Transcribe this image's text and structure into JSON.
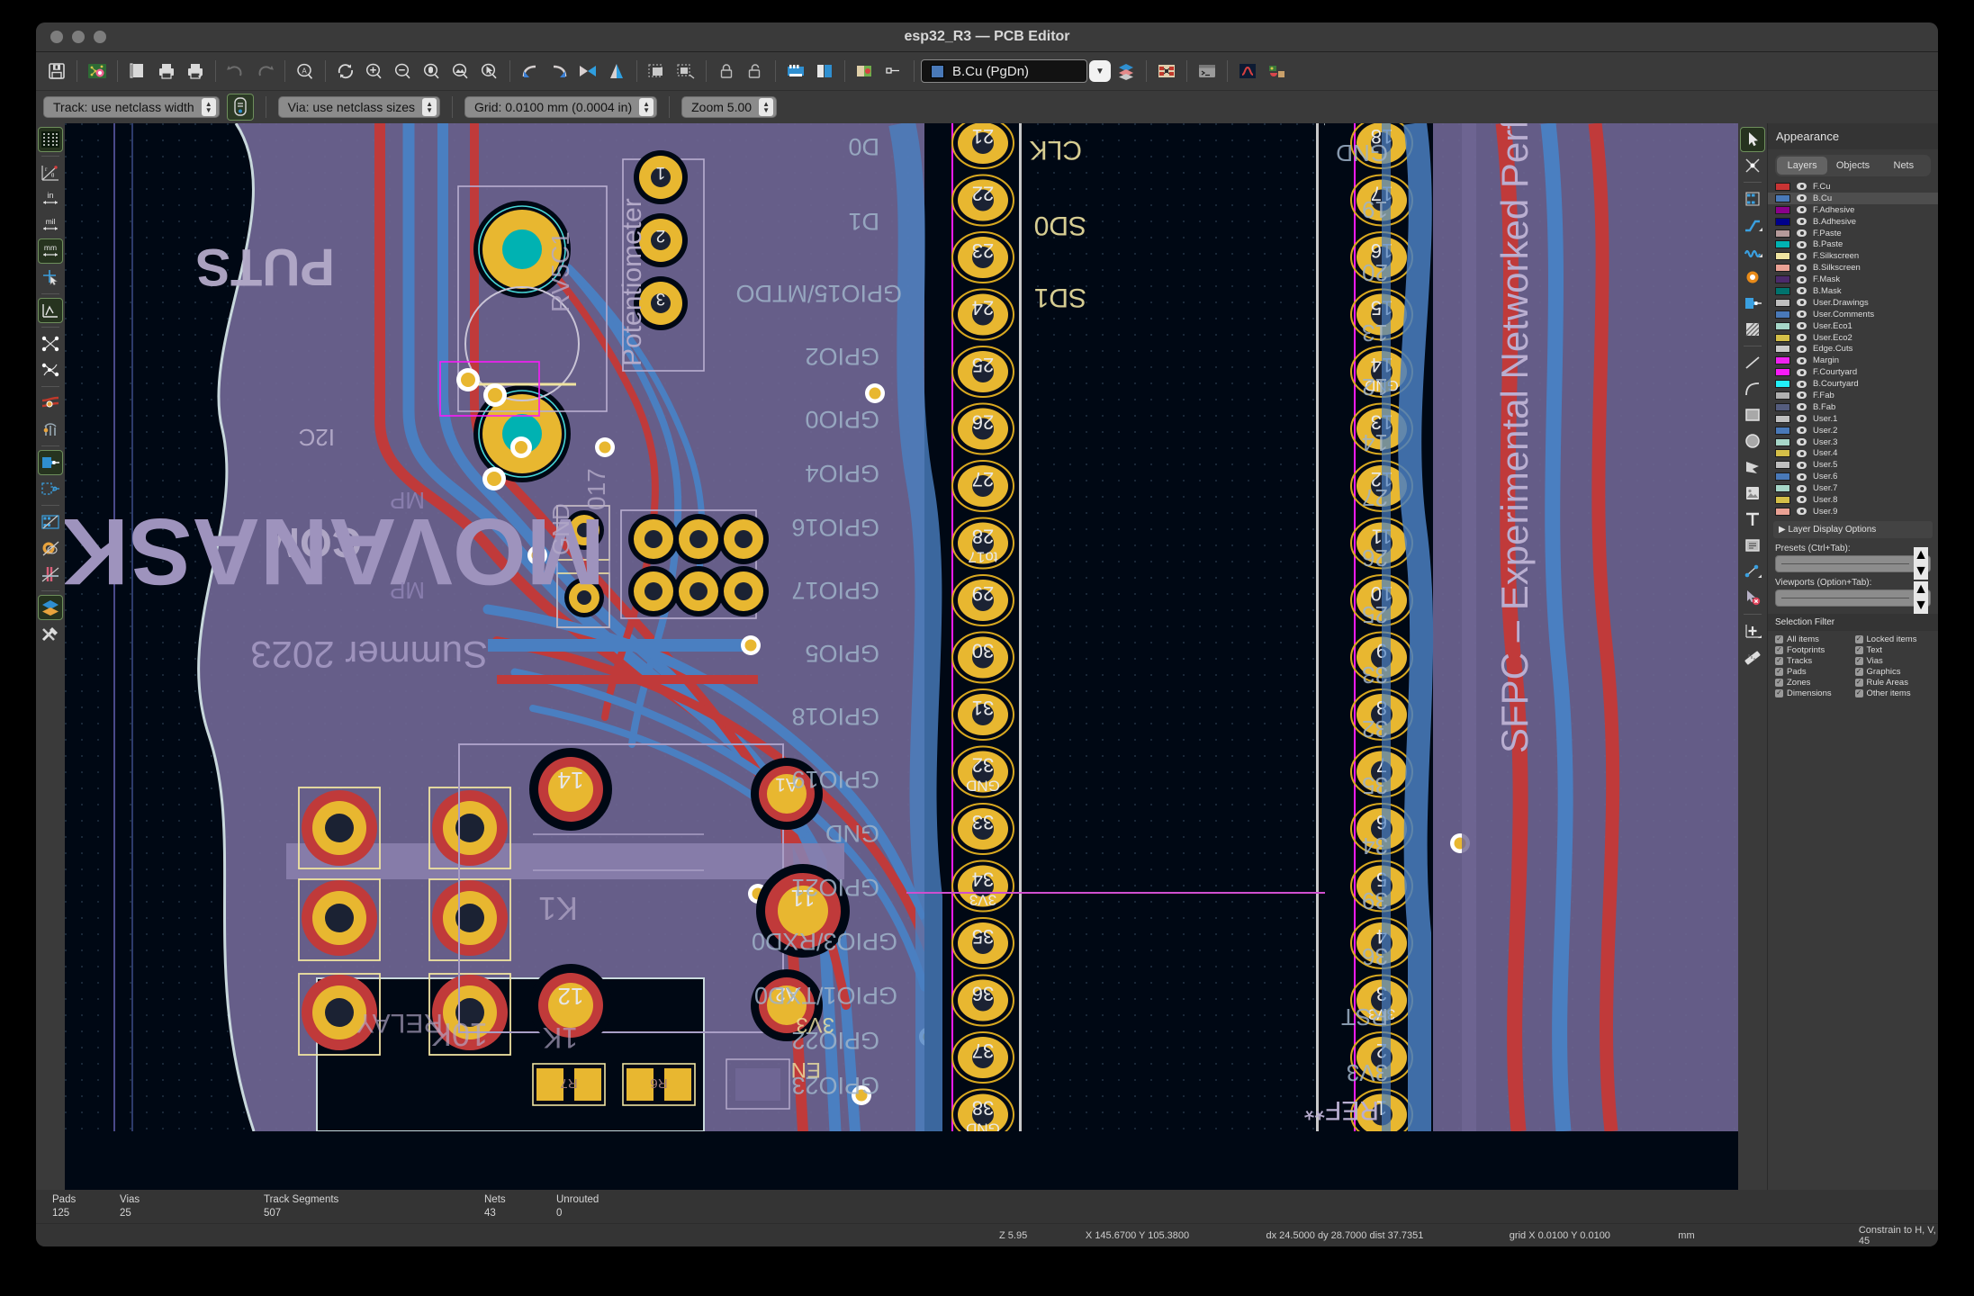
{
  "window": {
    "title": "esp32_R3 — PCB Editor"
  },
  "toolbar_main": [
    {
      "name": "save-icon",
      "label": "Save"
    },
    {
      "name": "board-setup-icon",
      "label": "Board Setup"
    },
    {
      "name": "page-settings-icon",
      "label": "Page Settings"
    },
    {
      "name": "print-icon",
      "label": "Print"
    },
    {
      "name": "plot-icon",
      "label": "Plot"
    },
    {
      "name": "undo-icon",
      "label": "Undo"
    },
    {
      "name": "redo-icon",
      "label": "Redo"
    },
    {
      "name": "find-icon",
      "label": "Find"
    },
    {
      "name": "refresh-icon",
      "label": "Refresh"
    },
    {
      "name": "zoom-in-icon",
      "label": "Zoom In"
    },
    {
      "name": "zoom-out-icon",
      "label": "Zoom Out"
    },
    {
      "name": "zoom-fit-icon",
      "label": "Zoom to Fit"
    },
    {
      "name": "zoom-objects-icon",
      "label": "Zoom to Objects"
    },
    {
      "name": "zoom-selection-icon",
      "label": "Zoom to Selection"
    },
    {
      "name": "rotate-ccw-icon",
      "label": "Rotate Counterclockwise"
    },
    {
      "name": "rotate-cw-icon",
      "label": "Rotate Clockwise"
    },
    {
      "name": "mirror-h-icon",
      "label": "Mirror Horizontally"
    },
    {
      "name": "mirror-v-icon",
      "label": "Mirror Vertically"
    },
    {
      "name": "group-icon",
      "label": "Group"
    },
    {
      "name": "ungroup-icon",
      "label": "Ungroup"
    },
    {
      "name": "footprint-lock-icon",
      "label": "Lock"
    },
    {
      "name": "footprint-unlock-icon",
      "label": "Unlock"
    },
    {
      "name": "drc-icon",
      "label": "Design Rules Checker"
    },
    {
      "name": "footprint-editor-icon",
      "label": "Footprint Editor"
    },
    {
      "name": "footprint-library-icon",
      "label": "Footprint Library"
    },
    {
      "name": "netlist-icon",
      "label": "Netlist"
    }
  ],
  "toolbar_aux": {
    "track": {
      "value": "Track: use netclass width"
    },
    "track_edit_icon": "track-width-edit-icon",
    "via": {
      "value": "Via: use netclass sizes"
    },
    "grid": {
      "value": "Grid: 0.0100 mm (0.0004 in)"
    },
    "zoom": {
      "value": "Zoom 5.00"
    }
  },
  "layer_selector": {
    "value": "B.Cu (PgDn)",
    "color": "#4979b8",
    "icons": [
      "layers-stack-icon",
      "terminal-icon",
      "python-icon",
      "plugin-icon",
      "3d-viewer-icon",
      "ratsnest-icon"
    ]
  },
  "left_toolbar": [
    {
      "name": "toggle-grid-icon",
      "active": true
    },
    {
      "name": "polar-coordinates-icon",
      "active": false
    },
    {
      "name": "units-inches-icon",
      "active": false
    },
    {
      "name": "units-mils-icon",
      "active": false
    },
    {
      "name": "units-mm-icon",
      "active": true
    },
    {
      "name": "cursor-fullscreen-icon",
      "active": false
    },
    {
      "name": "show-ratsnest-icon",
      "active": true
    },
    {
      "name": "curved-ratsnest-icon",
      "active": false
    },
    {
      "name": "net-colors-icon",
      "active": false
    },
    {
      "name": "ratsnest-mode-icon",
      "active": false
    },
    {
      "name": "zone-filled-icon",
      "active": true
    },
    {
      "name": "zone-outline-icon",
      "active": false
    },
    {
      "name": "footprint-sketch-icon",
      "active": false
    },
    {
      "name": "pad-sketch-icon",
      "active": false
    },
    {
      "name": "track-sketch-icon",
      "active": false
    },
    {
      "name": "layers-contrast-icon",
      "active": true
    },
    {
      "name": "preferences-icon",
      "active": false
    }
  ],
  "right_toolbar": [
    {
      "name": "select-tool-icon",
      "active": true
    },
    {
      "name": "highlight-net-icon",
      "active": false
    },
    {
      "name": "place-footprint-icon",
      "active": false
    },
    {
      "name": "route-track-icon",
      "active": false
    },
    {
      "name": "route-differential-icon",
      "active": false
    },
    {
      "name": "add-via-icon",
      "active": false
    },
    {
      "name": "add-zone-icon",
      "active": false
    },
    {
      "name": "add-rule-area-icon",
      "active": false
    },
    {
      "name": "draw-line-icon",
      "active": false
    },
    {
      "name": "draw-arc-icon",
      "active": false
    },
    {
      "name": "draw-rectangle-icon",
      "active": false
    },
    {
      "name": "draw-circle-icon",
      "active": false
    },
    {
      "name": "draw-polygon-icon",
      "active": false
    },
    {
      "name": "add-image-icon",
      "active": false
    },
    {
      "name": "add-text-icon",
      "active": false
    },
    {
      "name": "add-textbox-icon",
      "active": false
    },
    {
      "name": "add-dimension-icon",
      "active": false
    },
    {
      "name": "delete-tool-icon",
      "active": false
    },
    {
      "name": "set-origin-icon",
      "active": false
    },
    {
      "name": "measure-tool-icon",
      "active": false
    }
  ],
  "appearance": {
    "title": "Appearance",
    "tabs": [
      {
        "label": "Layers",
        "selected": true
      },
      {
        "label": "Objects",
        "selected": false
      },
      {
        "label": "Nets",
        "selected": false
      }
    ],
    "layers": [
      {
        "name": "F.Cu",
        "color": "#c83434",
        "visible": true,
        "selected": false
      },
      {
        "name": "B.Cu",
        "color": "#4979b8",
        "visible": true,
        "selected": true
      },
      {
        "name": "F.Adhesive",
        "color": "#8b008b",
        "visible": true,
        "selected": false
      },
      {
        "name": "B.Adhesive",
        "color": "#00008b",
        "visible": true,
        "selected": false
      },
      {
        "name": "F.Paste",
        "color": "#b59a9a",
        "visible": true,
        "selected": false
      },
      {
        "name": "B.Paste",
        "color": "#00b2b2",
        "visible": true,
        "selected": false
      },
      {
        "name": "F.Silkscreen",
        "color": "#efe3a0",
        "visible": true,
        "selected": false
      },
      {
        "name": "B.Silkscreen",
        "color": "#eaa194",
        "visible": true,
        "selected": false
      },
      {
        "name": "F.Mask",
        "color": "#4b2a6b",
        "visible": true,
        "selected": false
      },
      {
        "name": "B.Mask",
        "color": "#00736e",
        "visible": true,
        "selected": false
      },
      {
        "name": "User.Drawings",
        "color": "#bfbfbf",
        "visible": true,
        "selected": false
      },
      {
        "name": "User.Comments",
        "color": "#4979b8",
        "visible": true,
        "selected": false
      },
      {
        "name": "User.Eco1",
        "color": "#a6d6c8",
        "visible": true,
        "selected": false
      },
      {
        "name": "User.Eco2",
        "color": "#d4bf48",
        "visible": true,
        "selected": false
      },
      {
        "name": "Edge.Cuts",
        "color": "#c8c8c8",
        "visible": true,
        "selected": false
      },
      {
        "name": "Margin",
        "color": "#ef22ef",
        "visible": true,
        "selected": false
      },
      {
        "name": "F.Courtyard",
        "color": "#f81bf8",
        "visible": true,
        "selected": false
      },
      {
        "name": "B.Courtyard",
        "color": "#22eff8",
        "visible": true,
        "selected": false
      },
      {
        "name": "F.Fab",
        "color": "#b0b0b0",
        "visible": true,
        "selected": false
      },
      {
        "name": "B.Fab",
        "color": "#555d7e",
        "visible": true,
        "selected": false
      },
      {
        "name": "User.1",
        "color": "#bfbfbf",
        "visible": true,
        "selected": false
      },
      {
        "name": "User.2",
        "color": "#4979b8",
        "visible": true,
        "selected": false
      },
      {
        "name": "User.3",
        "color": "#a6d6c8",
        "visible": true,
        "selected": false
      },
      {
        "name": "User.4",
        "color": "#d4bf48",
        "visible": true,
        "selected": false
      },
      {
        "name": "User.5",
        "color": "#bfbfbf",
        "visible": true,
        "selected": false
      },
      {
        "name": "User.6",
        "color": "#4979b8",
        "visible": true,
        "selected": false
      },
      {
        "name": "User.7",
        "color": "#a6d6c8",
        "visible": true,
        "selected": false
      },
      {
        "name": "User.8",
        "color": "#d4bf48",
        "visible": true,
        "selected": false
      },
      {
        "name": "User.9",
        "color": "#eaa194",
        "visible": true,
        "selected": false
      }
    ],
    "layer_display_options": "Layer Display Options",
    "presets_label": "Presets (Ctrl+Tab):",
    "presets_value": "",
    "viewports_label": "Viewports (Option+Tab):",
    "viewports_value": "",
    "selection_filter": {
      "title": "Selection Filter",
      "items": [
        {
          "label": "All items",
          "checked": true
        },
        {
          "label": "Locked items",
          "checked": true
        },
        {
          "label": "Footprints",
          "checked": true
        },
        {
          "label": "Text",
          "checked": true
        },
        {
          "label": "Tracks",
          "checked": true
        },
        {
          "label": "Vias",
          "checked": true
        },
        {
          "label": "Pads",
          "checked": true
        },
        {
          "label": "Graphics",
          "checked": true
        },
        {
          "label": "Zones",
          "checked": true
        },
        {
          "label": "Rule Areas",
          "checked": true
        },
        {
          "label": "Dimensions",
          "checked": true
        },
        {
          "label": "Other items",
          "checked": true
        }
      ]
    }
  },
  "status": {
    "counters": [
      {
        "label": "Pads",
        "value": "125"
      },
      {
        "label": "Vias",
        "value": "25"
      },
      {
        "label": "Track Segments",
        "value": "507"
      },
      {
        "label": "Nets",
        "value": "43"
      },
      {
        "label": "Unrouted",
        "value": "0"
      }
    ],
    "zoom": "Z 5.95",
    "position": "X 145.6700  Y 105.3800",
    "delta": "dx 24.5000  dy 28.7000  dist 37.7351",
    "grid": "grid X 0.0100  Y 0.0100",
    "units": "mm",
    "constraint": "Constrain to H, V, 45"
  },
  "canvas": {
    "colors": {
      "background": "#000814",
      "f_cu": "#c03a3a",
      "b_cu": "#4a7fc1",
      "pad": "#e8b730",
      "pad_hole": "#00b2b2",
      "silk_back": "#eaa194",
      "silk_front": "#efe3a0",
      "mask_back": "#6f6694",
      "edge_cuts": "#c8d8dc",
      "courtyard": "#f81bf8",
      "ratsnest": "#cf4fcf",
      "via": "#e8b730",
      "red_pad": "#c03a3a"
    },
    "silkscreen_texts": [
      "PUTS",
      "Potentiometer",
      "I2C",
      "MP",
      "COM",
      "MOVANASKM",
      "Summer 2023",
      "RELAY",
      "R7",
      "R6",
      "10K",
      "1K",
      "K1",
      "A1",
      "A2",
      "GND",
      "3V3",
      "RST",
      "SFPC – Experimental Networked Performance",
      "GPIO15/MTDO",
      "GPIO2",
      "GPIO0",
      "GPIO4",
      "GPIO16",
      "GPIO17",
      "GPIO5",
      "GPIO18",
      "GPIO19",
      "GPIO21",
      "GPIO3/RXD0",
      "GPIO1/TXD0",
      "GPIO22",
      "GPIO23",
      "GND",
      "3V3"
    ],
    "pad_numbers_center": [
      "21",
      "22",
      "23",
      "24",
      "25",
      "26",
      "27",
      "28",
      "29",
      "30",
      "31",
      "32",
      "33",
      "34",
      "35",
      "36",
      "37",
      "38"
    ],
    "pad_numbers_right": [
      "18",
      "17",
      "16",
      "15",
      "14",
      "13",
      "12",
      "11",
      "10",
      "9",
      "8",
      "7",
      "6",
      "5",
      "4",
      "3",
      "2",
      "1"
    ],
    "pad_net_labels": [
      "GND",
      "3V3",
      "RST",
      "to17",
      "+3V3"
    ],
    "ratsnest_line_color": "#cf4fcf"
  }
}
